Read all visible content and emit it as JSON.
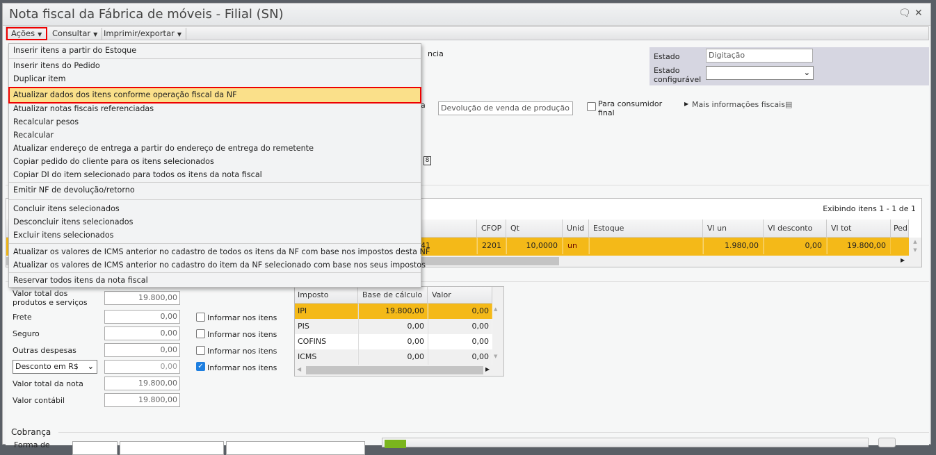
{
  "window": {
    "title": "Nota fiscal da Fábrica de móveis - Filial (SN)",
    "icons": [
      "comment-icon",
      "close-icon"
    ]
  },
  "menubar": {
    "items": [
      "Ações",
      "Consultar",
      "Imprimir/exportar"
    ]
  },
  "actions_menu": {
    "items": [
      "Inserir itens a partir do Estoque",
      "Inserir itens do Pedido",
      "Duplicar item",
      "Atualizar dados dos itens conforme operação fiscal da NF",
      "Atualizar notas fiscais referenciadas",
      "Recalcular pesos",
      "Recalcular",
      "Atualizar endereço de entrega a partir do endereço de entrega do remetente",
      "Copiar pedido do cliente para os itens selecionados",
      "Copiar DI do item selecionado para todos os itens da nota fiscal",
      "Emitir NF de devolução/retorno",
      "Concluir itens selecionados",
      "Desconcluir itens selecionados",
      "Excluir itens selecionados",
      "Atualizar os valores de ICMS anterior no cadastro de todos os itens da NF com base nos impostos desta NF",
      "Atualizar os valores de ICMS anterior no cadastro do item da NF selecionado com base nos seus impostos",
      "Reservar todos itens da nota fiscal"
    ],
    "highlighted": "Atualizar dados dos itens conforme operação fiscal da NF"
  },
  "header": {
    "partial_label_1": "ncia",
    "partial_label_2": "a",
    "operation_value": "Devolução de venda de produção d",
    "consumer_final_label": "Para consumidor final",
    "more_fiscal_label": "Mais informações fiscais",
    "estado_label": "Estado",
    "estado_value": "Digitação",
    "estado_config_label": "Estado configurável",
    "estado_config_value": ""
  },
  "items_grid": {
    "paging": "Exibindo itens 1 - 1 de 1",
    "columns": [
      "CFOP",
      "Qt",
      "Unid",
      "Estoque",
      "Vl un",
      "Vl desconto",
      "Vl tot",
      "Pedi"
    ],
    "rows": [
      {
        "partial": "41",
        "cfop": "2201",
        "qt": "10,0000",
        "unid": "un",
        "estoque": "",
        "vl_un": "1.980,00",
        "vl_desconto": "0,00",
        "vl_tot": "19.800,00"
      }
    ]
  },
  "totals": {
    "total_products_label": "Valor total dos produtos e serviços",
    "total_products": "19.800,00",
    "frete_label": "Frete",
    "frete": "0,00",
    "seguro_label": "Seguro",
    "seguro": "0,00",
    "outras_label": "Outras despesas",
    "outras": "0,00",
    "desconto_select": "Desconto em R$",
    "desconto": "0,00",
    "total_nota_label": "Valor total da nota",
    "total_nota": "19.800,00",
    "contabil_label": "Valor contábil",
    "contabil": "19.800,00",
    "informar_label": "Informar nos itens",
    "informar_checked": [
      false,
      false,
      false,
      true
    ]
  },
  "tax_grid": {
    "columns": [
      "Imposto",
      "Base de cálculo",
      "Valor"
    ],
    "rows": [
      [
        "IPI",
        "19.800,00",
        "0,00"
      ],
      [
        "PIS",
        "0,00",
        "0,00"
      ],
      [
        "COFINS",
        "0,00",
        "0,00"
      ],
      [
        "ICMS",
        "0,00",
        "0,00"
      ]
    ]
  },
  "cobranca": {
    "title": "Cobrança",
    "forma_label": "Forma de"
  },
  "colors": {
    "selected_row": "#f4b918",
    "menu_highlight": "#fae08a",
    "annotation": "#e00000",
    "state_panel": "#d6d6e1"
  }
}
